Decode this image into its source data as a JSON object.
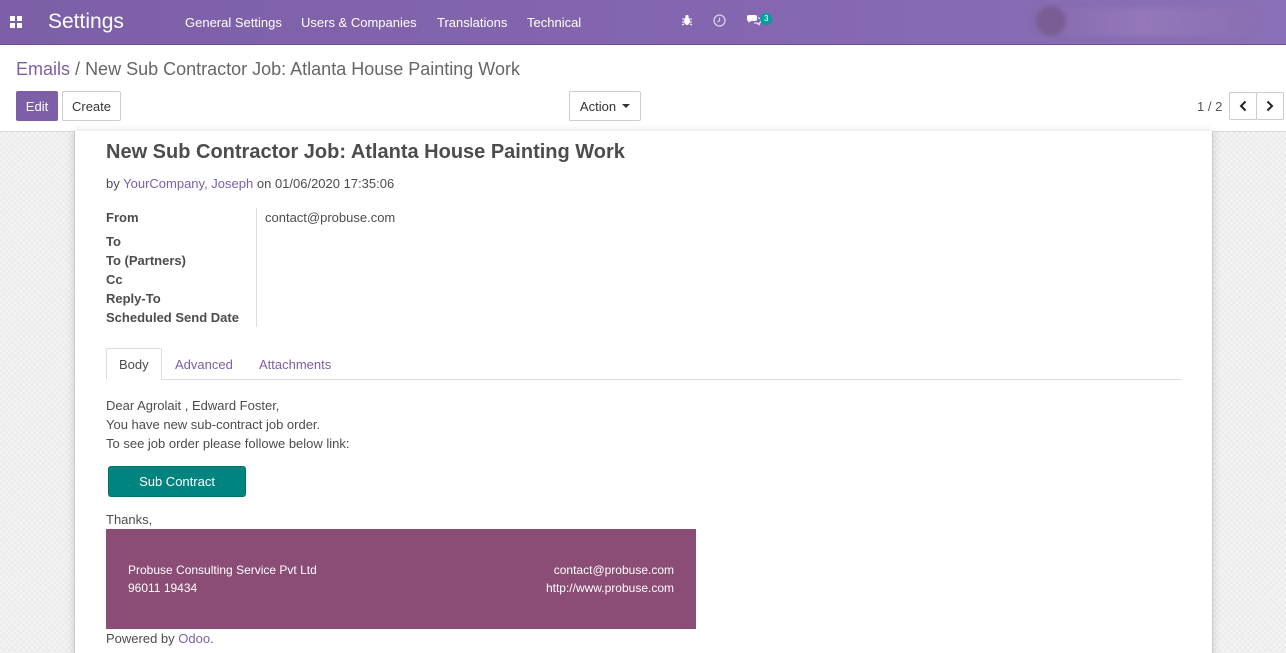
{
  "navbar": {
    "app_title": "Settings",
    "menu": [
      "General Settings",
      "Users & Companies",
      "Translations",
      "Technical"
    ],
    "chat_badge": "3"
  },
  "breadcrumb": {
    "parent": "Emails",
    "separator": "/",
    "current": "New Sub Contractor Job: Atlanta House Painting Work"
  },
  "toolbar": {
    "edit_label": "Edit",
    "create_label": "Create",
    "action_label": "Action",
    "pager": "1 / 2"
  },
  "mail": {
    "subject": "New Sub Contractor Job: Atlanta House Painting Work",
    "by_prefix": "by",
    "author": "YourCompany, Joseph",
    "on_prefix": "on",
    "date": "01/06/2020 17:35:06",
    "fields": {
      "from_label": "From",
      "from_value": "contact@probuse.com",
      "to_label": "To",
      "to_partners_label": "To (Partners)",
      "cc_label": "Cc",
      "reply_to_label": "Reply-To",
      "scheduled_label": "Scheduled Send Date"
    }
  },
  "tabs": [
    "Body",
    "Advanced",
    "Attachments"
  ],
  "body": {
    "line1": "Dear Agrolait , Edward Foster,",
    "line2": "You have new sub-contract job order.",
    "line3": "To see job order please followe below link:",
    "button_label": "Sub Contract",
    "thanks": "Thanks,"
  },
  "footer": {
    "company": "Probuse Consulting Service Pvt Ltd",
    "phone": "96011 19434",
    "email": "contact@probuse.com",
    "website": "http://www.probuse.com",
    "color": "#8b4c75"
  },
  "powered": {
    "prefix": "Powered by",
    "link": "Odoo",
    "suffix": "."
  },
  "colors": {
    "brand": "#7c5fa6",
    "teal_button": "#00847f"
  }
}
